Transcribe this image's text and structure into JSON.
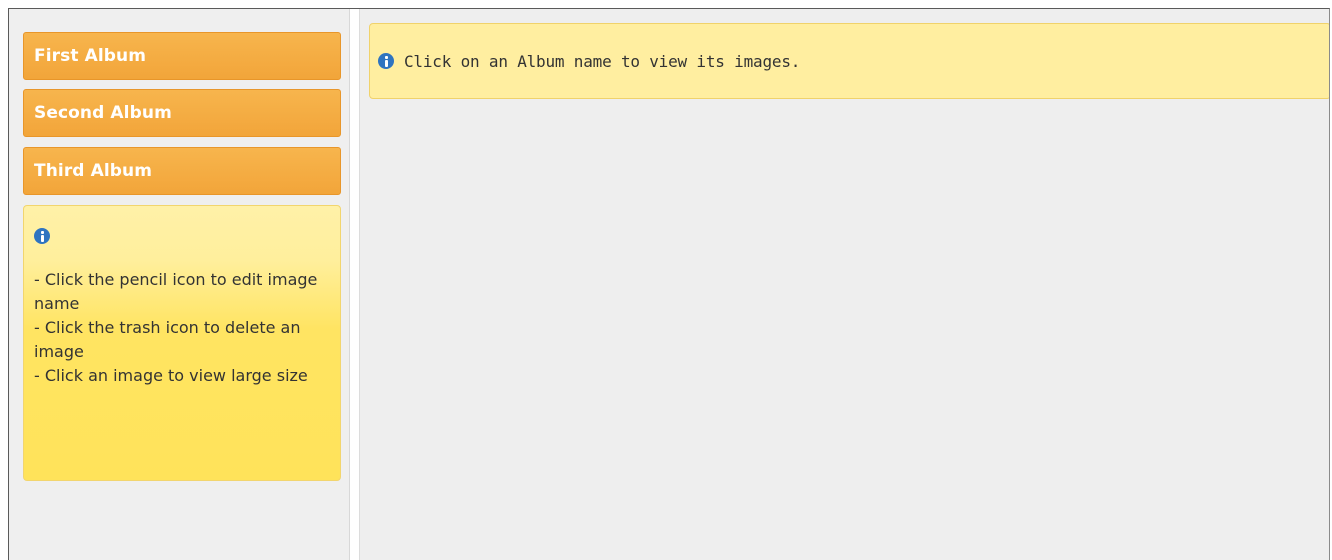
{
  "albums": [
    {
      "label": "First Album"
    },
    {
      "label": "Second Album"
    },
    {
      "label": "Third Album"
    }
  ],
  "sidebar_info": {
    "icon": "info-icon",
    "lines": [
      "- Click the pencil icon to edit image name",
      "- Click the trash icon to delete an image",
      "- Click an image to view large size"
    ]
  },
  "main_info": {
    "icon": "info-icon",
    "text": "Click on an Album name to view its images."
  },
  "colors": {
    "album_button": "#f4ab42",
    "info_box": "#ffe35a",
    "info_icon": "#2f74c0"
  }
}
